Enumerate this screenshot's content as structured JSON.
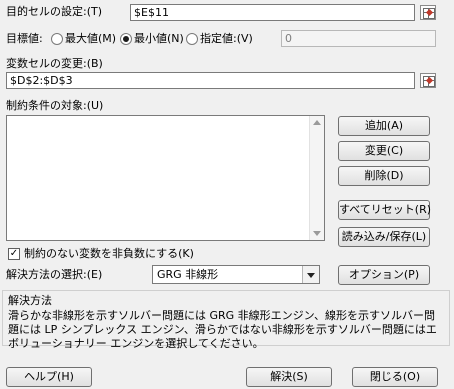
{
  "objective": {
    "label": "目的セルの設定:(T)",
    "value": "$E$11"
  },
  "target": {
    "label": "目標値:",
    "options": [
      {
        "label": "最大値(M)",
        "selected": false
      },
      {
        "label": "最小値(N)",
        "selected": true
      },
      {
        "label": "指定値:(V)",
        "selected": false
      }
    ],
    "value_of": "0"
  },
  "variables": {
    "label": "変数セルの変更:(B)",
    "value": "$D$2:$D$3"
  },
  "constraints": {
    "label": "制約条件の対象:(U)",
    "items": []
  },
  "side_buttons": {
    "add": "追加(A)",
    "change": "変更(C)",
    "delete": "削除(D)",
    "reset_all": "すべてリセット(R)",
    "load_save": "読み込み/保存(L)"
  },
  "nonneg": {
    "label": "制約のない変数を非負数にする(K)",
    "checked": true
  },
  "method": {
    "label": "解決方法の選択:(E)",
    "selected": "GRG 非線形",
    "options_label": "オプション(P)"
  },
  "method_desc": {
    "title": "解決方法",
    "text": "滑らかな非線形を示すソルバー問題には GRG 非線形エンジン、線形を示すソルバー問題には LP シンプレックス エンジン、滑らかではない非線形を示すソルバー問題にはエボリューショナリー エンジンを選択してください。"
  },
  "footer": {
    "help": "ヘルプ(H)",
    "solve": "解決(S)",
    "close": "閉じる(O)"
  },
  "icons": {
    "ref_button": "range-select-icon",
    "check": "checkmark-icon",
    "dropdown": "chevron-down-icon"
  }
}
